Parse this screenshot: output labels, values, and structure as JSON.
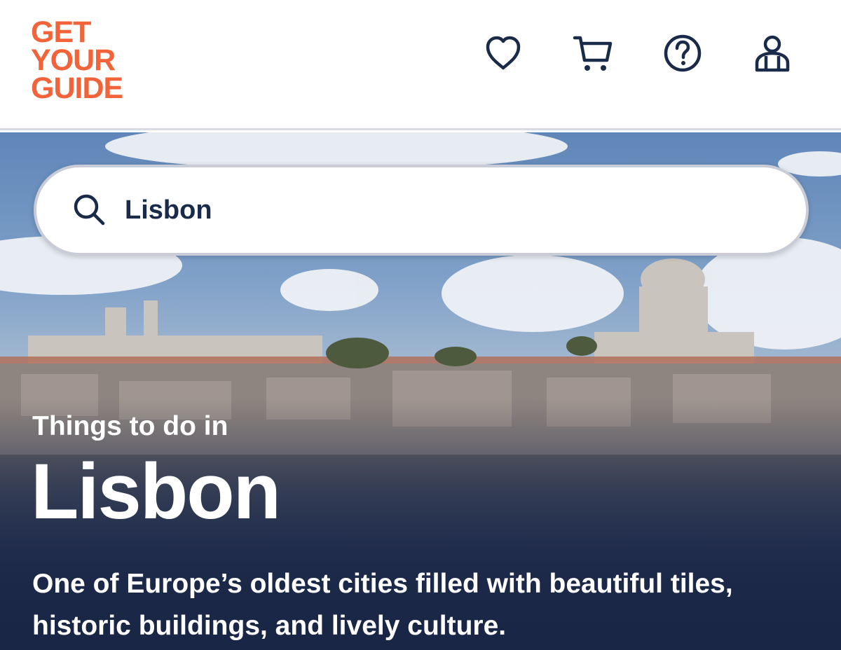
{
  "header": {
    "logo": {
      "line1": "GET",
      "line2": "YOUR",
      "line3": "GUIDE"
    },
    "icons": [
      {
        "name": "wishlist",
        "icon": "heart-icon"
      },
      {
        "name": "cart",
        "icon": "cart-icon"
      },
      {
        "name": "help",
        "icon": "help-icon"
      },
      {
        "name": "profile",
        "icon": "profile-icon"
      }
    ]
  },
  "search": {
    "value": "Lisbon",
    "icon": "search-icon"
  },
  "hero": {
    "subtitle": "Things to do in",
    "title": "Lisbon",
    "description": "One of Europe’s oldest cities filled with beautiful tiles, historic buildings, and lively culture."
  },
  "colors": {
    "brand": "#f2633a",
    "ink": "#1a2b49",
    "hero_overlay": "#1a2646"
  }
}
